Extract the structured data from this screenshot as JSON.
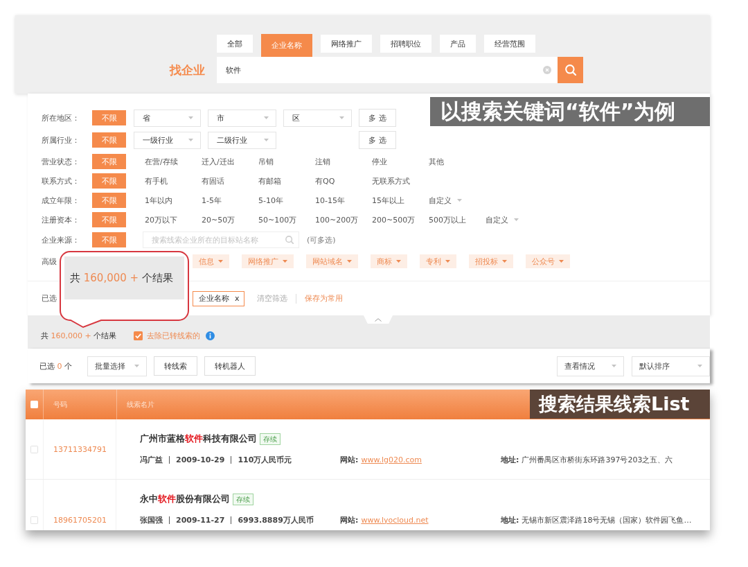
{
  "search_header": {
    "tabs": [
      {
        "label": "全部",
        "selected": false
      },
      {
        "label": "企业名称",
        "selected": true
      },
      {
        "label": "网络推广",
        "selected": false
      },
      {
        "label": "招聘职位",
        "selected": false
      },
      {
        "label": "产品",
        "selected": false
      },
      {
        "label": "经营范围",
        "selected": false
      }
    ],
    "title": "找企业",
    "search": {
      "value": "软件"
    }
  },
  "annotation_top": {
    "text": "以搜索关键词“软件”为例"
  },
  "filters": {
    "expanded": true,
    "rows": [
      {
        "kind": "dropdowns",
        "label": "所在地区：",
        "any": {
          "label": "不限",
          "selected": true
        },
        "dropdowns": [
          "省",
          "市",
          "区"
        ],
        "multi": "多选"
      },
      {
        "kind": "dropdowns",
        "label": "所属行业：",
        "any": {
          "label": "不限",
          "selected": true
        },
        "dropdowns": [
          "一级行业",
          "二级行业"
        ],
        "multi": "多选"
      },
      {
        "kind": "options",
        "label": "营业状态：",
        "any": {
          "label": "不限",
          "selected": true
        },
        "options": [
          {
            "label": "在营/存续",
            "kind": "plain",
            "selected": false
          },
          {
            "label": "迁入/迁出",
            "kind": "plain",
            "selected": false
          },
          {
            "label": "吊销",
            "kind": "plain",
            "selected": false
          },
          {
            "label": "注销",
            "kind": "plain",
            "selected": false
          },
          {
            "label": "停业",
            "kind": "plain",
            "selected": false
          },
          {
            "label": "其他",
            "kind": "plain",
            "selected": false
          }
        ]
      },
      {
        "kind": "options",
        "label": "联系方式：",
        "any": {
          "label": "不限",
          "selected": true
        },
        "options": [
          {
            "label": "有手机",
            "kind": "plain",
            "selected": false
          },
          {
            "label": "有固话",
            "kind": "plain",
            "selected": false
          },
          {
            "label": "有邮箱",
            "kind": "plain",
            "selected": false
          },
          {
            "label": "有QQ",
            "kind": "plain",
            "selected": false
          },
          {
            "label": "无联系方式",
            "kind": "plain",
            "selected": false
          }
        ]
      },
      {
        "kind": "options",
        "label": "成立年限：",
        "any": {
          "label": "不限",
          "selected": true
        },
        "options": [
          {
            "label": "1年以内",
            "kind": "plain",
            "selected": false
          },
          {
            "label": "1-5年",
            "kind": "plain",
            "selected": false
          },
          {
            "label": "5-10年",
            "kind": "plain",
            "selected": false
          },
          {
            "label": "10-15年",
            "kind": "plain",
            "selected": false
          },
          {
            "label": "15年以上",
            "kind": "plain",
            "selected": false
          },
          {
            "label": "自定义",
            "kind": "dropdown",
            "selected": false
          }
        ]
      },
      {
        "kind": "options",
        "label": "注册资本：",
        "any": {
          "label": "不限",
          "selected": true
        },
        "options": [
          {
            "label": "20万以下",
            "kind": "plain",
            "selected": false
          },
          {
            "label": "20~50万",
            "kind": "plain",
            "selected": false
          },
          {
            "label": "50~100万",
            "kind": "plain",
            "selected": false
          },
          {
            "label": "100~200万",
            "kind": "plain",
            "selected": false
          },
          {
            "label": "200~500万",
            "kind": "plain",
            "selected": false
          },
          {
            "label": "500万以上",
            "kind": "plain",
            "selected": false
          },
          {
            "label": "自定义",
            "kind": "dropdown",
            "selected": false
          }
        ]
      },
      {
        "kind": "source",
        "label": "企业来源：",
        "any": {
          "label": "不限",
          "selected": true
        },
        "search": {
          "placeholder": "搜索线索企业所在的目标站名称"
        },
        "note": "(可多选)"
      }
    ],
    "advanced": {
      "label": "高级",
      "chips": [
        "信息",
        "网络推广",
        "网站域名",
        "商标",
        "专利",
        "招投标",
        "公众号"
      ]
    },
    "selected": {
      "label": "已选",
      "tags": [
        {
          "label": "企业名称",
          "remove": "x"
        }
      ],
      "clear": "清空筛选",
      "save": "保存为常用"
    }
  },
  "callout": {
    "prefix": "共",
    "count": "160,000 +",
    "suffix": "个结果"
  },
  "summary": {
    "prefix": "共",
    "count": "160,000 +",
    "suffix": "个结果",
    "exclude": {
      "label": "去除已转线索的",
      "checked": true
    }
  },
  "toolbar": {
    "selected": {
      "prefix": "已选",
      "count": "0",
      "suffix": "个"
    },
    "batch": "批量选择",
    "buttons": [
      "转线索",
      "转机器人"
    ],
    "view": "查看情况",
    "sort": "默认排序"
  },
  "table": {
    "header_checked": false,
    "columns": [
      "号码",
      "线索名片"
    ],
    "rows": [
      {
        "checked": false,
        "phone": "13711334791",
        "name": [
          {
            "text": "广州市蓝格",
            "highlight": false
          },
          {
            "text": "软件",
            "highlight": true
          },
          {
            "text": "科技有限公司",
            "highlight": false
          }
        ],
        "status": "存续",
        "person": "冯广益",
        "date": "2009-10-29",
        "capital": "110万人民币元",
        "website_label": "网站:",
        "website": "www.lg020.com",
        "address_label": "地址:",
        "address": "广州番禺区市桥街东环路397号203之五、六"
      },
      {
        "checked": false,
        "phone": "18961705201",
        "name": [
          {
            "text": "永中",
            "highlight": false
          },
          {
            "text": "软件",
            "highlight": true
          },
          {
            "text": "股份有限公司",
            "highlight": false
          }
        ],
        "status": "存续",
        "person": "张国强",
        "date": "2009-11-27",
        "capital": "6993.8889万人民币",
        "website_label": "网站:",
        "website": "www.lyocloud.net",
        "address_label": "地址:",
        "address": "无锡市新区震泽路18号无锡（国家）软件园飞鱼…"
      }
    ]
  },
  "annotation_bottom": {
    "text": "搜索结果线索List"
  }
}
